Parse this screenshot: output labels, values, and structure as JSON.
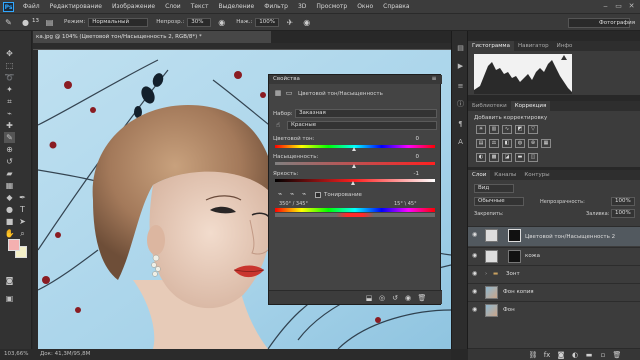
{
  "app": {
    "logo": "Ps"
  },
  "menu": [
    "Файл",
    "Редактирование",
    "Изображение",
    "Слои",
    "Текст",
    "Выделение",
    "Фильтр",
    "3D",
    "Просмотр",
    "Окно",
    "Справка"
  ],
  "window_controls": [
    "‒",
    "▭",
    "✕"
  ],
  "options": {
    "mode_label": "Режим:",
    "mode_value": "Нормальный",
    "opacity_label": "Непрозр.:",
    "opacity_value": "30%",
    "flow_label": "Наж.:",
    "flow_value": "100%",
    "brush_size": "13",
    "workspace": "Фотография"
  },
  "document": {
    "tab": "ка.jpg @ 104% (Цветовой тон/Насыщенность 2, RGB/8*) *"
  },
  "status": {
    "zoom": "103,66%",
    "doc_info": "Док: 41,3M/95,8M"
  },
  "properties": {
    "title": "Свойства",
    "subtitle": "Цветовой тон/Насыщенность",
    "preset_label": "Набор:",
    "preset_value": "Заказная",
    "channel_value": "Красные",
    "hue_label": "Цветовой тон:",
    "hue_value": "0",
    "sat_label": "Насыщенность:",
    "sat_value": "0",
    "light_label": "Яркость:",
    "light_value": "-1",
    "colorize_label": "Тонирование",
    "range_left": "350° / 345°",
    "range_right": "15° \\ 45°"
  },
  "histogram": {
    "tabs": [
      "Гистограмма",
      "Навигатор",
      "Инфо"
    ]
  },
  "adjustments": {
    "tabs": [
      "Библиотеки",
      "Коррекция"
    ],
    "hint": "Добавить корректировку"
  },
  "layers": {
    "tabs": [
      "Слои",
      "Каналы",
      "Контуры"
    ],
    "filter": "Вид",
    "blend": "Обычные",
    "opacity_label": "Непрозрачность:",
    "opacity_value": "100%",
    "lock_label": "Закрепить:",
    "fill_label": "Заливка:",
    "fill_value": "100%",
    "items": [
      {
        "name": "Цветовой тон/Насыщенность 2",
        "selected": true
      },
      {
        "name": "кожа",
        "selected": false
      },
      {
        "name": "Зонт",
        "selected": false
      },
      {
        "name": "Фон копия",
        "selected": false
      },
      {
        "name": "Фон",
        "selected": false
      }
    ],
    "footer_icons": [
      "fx"
    ]
  },
  "colors": {
    "accent": "#31a8ff",
    "foreground": "#f4b0b0",
    "background": "#f4f0c8"
  }
}
